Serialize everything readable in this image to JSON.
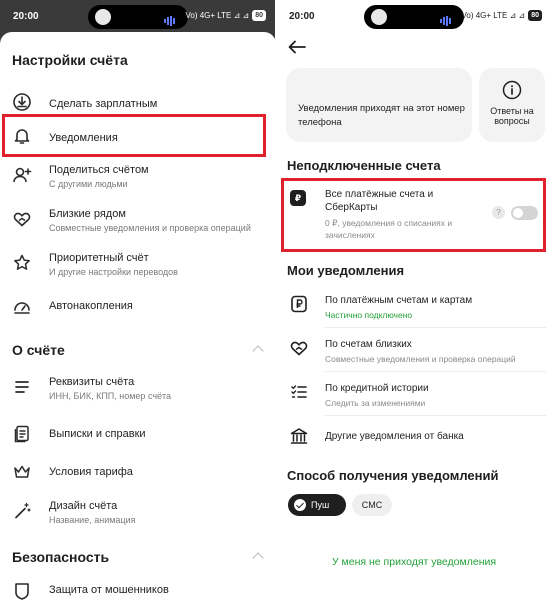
{
  "left": {
    "status": {
      "time": "20:00",
      "net": "Vo) 4G+ LTE ⊿ ⊿",
      "battery": "80"
    },
    "title": "Настройки счёта",
    "items_top": [
      {
        "label": "Сделать зарплатным",
        "sub": "",
        "icon": "salary-download-icon"
      },
      {
        "label": "Уведомления",
        "sub": "",
        "icon": "bell-icon"
      },
      {
        "label": "Поделиться счётом",
        "sub": "С другими людьми",
        "icon": "add-person-icon"
      },
      {
        "label": "Близкие рядом",
        "sub": "Совместные уведомления и проверка операций",
        "icon": "heart-hands-icon"
      },
      {
        "label": "Приоритетный счёт",
        "sub": "И другие настройки переводов",
        "icon": "star-badge-icon"
      },
      {
        "label": "Автонакопления",
        "sub": "",
        "icon": "savings-gauge-icon"
      }
    ],
    "section_about": "О счёте",
    "items_about": [
      {
        "label": "Реквизиты счёта",
        "sub": "ИНН, БИК, КПП, номер счёта",
        "icon": "list-icon"
      },
      {
        "label": "Выписки и справки",
        "sub": "",
        "icon": "documents-icon"
      },
      {
        "label": "Условия тарифа",
        "sub": "",
        "icon": "crown-icon"
      },
      {
        "label": "Дизайн счёта",
        "sub": "Название, анимация",
        "icon": "magic-wand-icon"
      }
    ],
    "section_security": "Безопасность",
    "items_security": [
      {
        "label": "Защита от мошенников",
        "sub": "",
        "icon": "shield-icon"
      }
    ],
    "highlight_color": "#e0202c"
  },
  "right": {
    "status": {
      "time": "20:00",
      "net": "Vo) 4G+ LTE ⊿ ⊿",
      "battery": "80"
    },
    "info_card_text": "Уведомления приходят на этот номер телефона",
    "faq_label": "Ответы на вопросы",
    "section_unconnected": "Неподключенные счета",
    "account": {
      "title": "Все платёжные счета и СберКарты",
      "sub": "0 ₽, уведомления о списаниях и зачислениях",
      "badge": "₽",
      "help": "?",
      "toggle_on": false
    },
    "section_my": "Мои уведомления",
    "notifications": [
      {
        "label": "По платёжным счетам и картам",
        "sub": "Частично подключено",
        "sub_green": true,
        "icon": "ruble-card-icon"
      },
      {
        "label": "По счетам близких",
        "sub": "Совместные уведомления и проверка операций",
        "sub_green": false,
        "icon": "heart-hands-icon"
      },
      {
        "label": "По кредитной истории",
        "sub": "Следить за изменениями",
        "sub_green": false,
        "icon": "checklist-icon"
      },
      {
        "label": "Другие уведомления от банка",
        "sub": "",
        "sub_green": false,
        "icon": "bank-icon"
      }
    ],
    "section_method": "Способ получения уведомлений",
    "method_push": "Пуш",
    "method_sms": "СМС",
    "help_link": "У меня не приходят уведомления",
    "accent_color": "#21a038"
  }
}
